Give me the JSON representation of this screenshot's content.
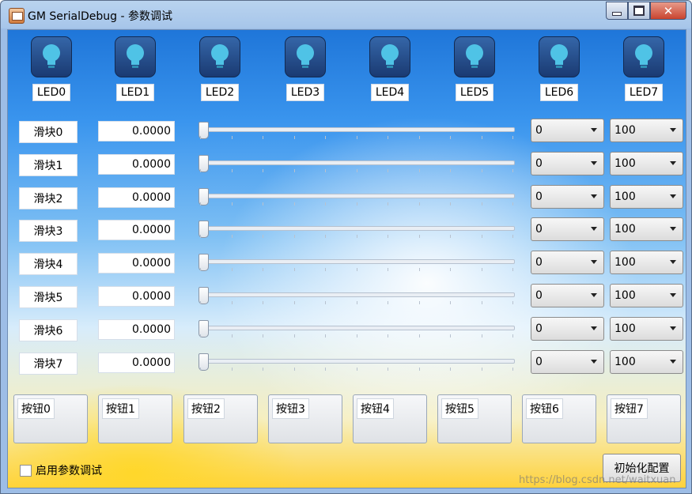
{
  "window": {
    "title": "GM SerialDebug - 参数调试"
  },
  "leds": [
    "LED0",
    "LED1",
    "LED2",
    "LED3",
    "LED4",
    "LED5",
    "LED6",
    "LED7"
  ],
  "sliders": [
    {
      "label": "滑块0",
      "value": "0.0000",
      "level": 0,
      "min": "0",
      "max": "100"
    },
    {
      "label": "滑块1",
      "value": "0.0000",
      "level": 0,
      "min": "0",
      "max": "100"
    },
    {
      "label": "滑块2",
      "value": "0.0000",
      "level": 0,
      "min": "0",
      "max": "100"
    },
    {
      "label": "滑块3",
      "value": "0.0000",
      "level": 0,
      "min": "0",
      "max": "100"
    },
    {
      "label": "滑块4",
      "value": "0.0000",
      "level": 0,
      "min": "0",
      "max": "100"
    },
    {
      "label": "滑块5",
      "value": "0.0000",
      "level": 0,
      "min": "0",
      "max": "100"
    },
    {
      "label": "滑块6",
      "value": "0.0000",
      "level": 0,
      "min": "0",
      "max": "100"
    },
    {
      "label": "滑块7",
      "value": "0.0000",
      "level": 0,
      "min": "0",
      "max": "100"
    }
  ],
  "buttons": [
    "按钮0",
    "按钮1",
    "按钮2",
    "按钮3",
    "按钮4",
    "按钮5",
    "按钮6",
    "按钮7"
  ],
  "footer": {
    "enable_label": "启用参数调试",
    "enable_checked": false,
    "init_label": "初始化配置"
  },
  "watermark": "https://blog.csdn.net/waitxuan",
  "colors": {
    "bulb_tile": "#1f4583",
    "bulb_glow": "#4fc3e6"
  }
}
